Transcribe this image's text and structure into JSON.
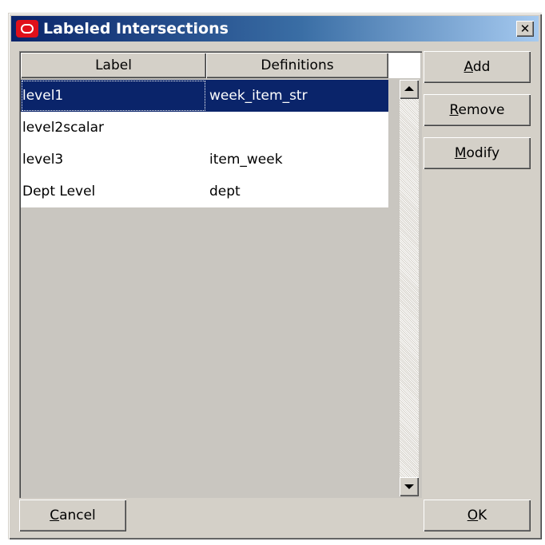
{
  "window": {
    "title": "Labeled Intersections",
    "close_label": "✕"
  },
  "grid": {
    "columns": [
      "Label",
      "Definitions"
    ],
    "rows": [
      {
        "label": "level1",
        "definition": "week_item_str",
        "selected": true
      },
      {
        "label": "level2scalar",
        "definition": ""
      },
      {
        "label": "level3",
        "definition": "item_week"
      },
      {
        "label": "Dept Level",
        "definition": "dept"
      }
    ]
  },
  "buttons": {
    "add": {
      "mnemonic": "A",
      "rest": "dd"
    },
    "remove": {
      "mnemonic": "R",
      "rest": "emove"
    },
    "modify": {
      "mnemonic": "M",
      "rest": "odify"
    },
    "cancel": {
      "mnemonic": "C",
      "rest": "ancel"
    },
    "ok": {
      "mnemonic": "O",
      "rest": "K"
    }
  },
  "colors": {
    "titlebar_start": "#0a246a",
    "titlebar_end": "#a6caf0",
    "selection": "#0a246a",
    "dialog_face": "#d4d0c8",
    "logo_red": "#e0101a"
  },
  "icons": {
    "logo": "oracle-logo-icon",
    "close": "close-icon",
    "scroll_up": "scroll-up-arrow-icon",
    "scroll_down": "scroll-down-arrow-icon"
  }
}
